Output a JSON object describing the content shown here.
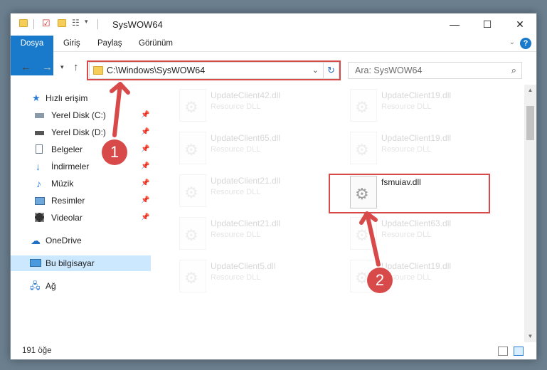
{
  "window": {
    "title": "SysWOW64"
  },
  "titlebar": {
    "minimize": "—",
    "maximize": "☐",
    "close": "✕"
  },
  "ribbon": {
    "tabs": [
      "Dosya",
      "Giriş",
      "Paylaş",
      "Görünüm"
    ],
    "help": "?"
  },
  "address": {
    "path": "C:\\Windows\\SysWOW64"
  },
  "search": {
    "placeholder": "Ara: SysWOW64"
  },
  "sidebar": {
    "items": [
      {
        "label": "Hızlı erişim",
        "icon": "star-icon",
        "pinned": false
      },
      {
        "label": "Yerel Disk (C:)",
        "icon": "drive-icon",
        "pinned": true
      },
      {
        "label": "Yerel Disk (D:)",
        "icon": "drive-icon",
        "pinned": true
      },
      {
        "label": "Belgeler",
        "icon": "document-icon",
        "pinned": true
      },
      {
        "label": "İndirmeler",
        "icon": "download-icon",
        "pinned": true
      },
      {
        "label": "Müzik",
        "icon": "music-icon",
        "pinned": true
      },
      {
        "label": "Resimler",
        "icon": "picture-icon",
        "pinned": true
      },
      {
        "label": "Videolar",
        "icon": "video-icon",
        "pinned": true
      },
      {
        "label": "OneDrive",
        "icon": "cloud-icon",
        "pinned": false
      },
      {
        "label": "Bu bilgisayar",
        "icon": "computer-icon",
        "pinned": false,
        "selected": true
      },
      {
        "label": "Ağ",
        "icon": "network-icon",
        "pinned": false
      }
    ]
  },
  "files": [
    {
      "name": "UpdateClient42.dll",
      "type": "Resource DLL",
      "faded": true
    },
    {
      "name": "UpdateClient19.dll",
      "type": "Resource DLL",
      "faded": true
    },
    {
      "name": "UpdateClient65.dll",
      "type": "Resource DLL",
      "faded": true
    },
    {
      "name": "UpdateClient19.dll",
      "type": "Resource DLL",
      "faded": true
    },
    {
      "name": "UpdateClient21.dll",
      "type": "Resource DLL",
      "faded": true
    },
    {
      "name": "fsmuiav.dll",
      "type": "",
      "faded": false
    },
    {
      "name": "UpdateClient21.dll",
      "type": "Resource DLL",
      "faded": true
    },
    {
      "name": "UpdateClient63.dll",
      "type": "Resource DLL",
      "faded": true
    },
    {
      "name": "UpdateClient5.dll",
      "type": "Resource DLL",
      "faded": true
    },
    {
      "name": "UpdateClient19.dll",
      "type": "Resource DLL",
      "faded": true
    }
  ],
  "status": {
    "count": "191 öğe"
  },
  "annotations": {
    "badge1": "1",
    "badge2": "2"
  },
  "colors": {
    "accent": "#1979ca",
    "highlight": "#d84a4a",
    "selected": "#cce8ff"
  }
}
